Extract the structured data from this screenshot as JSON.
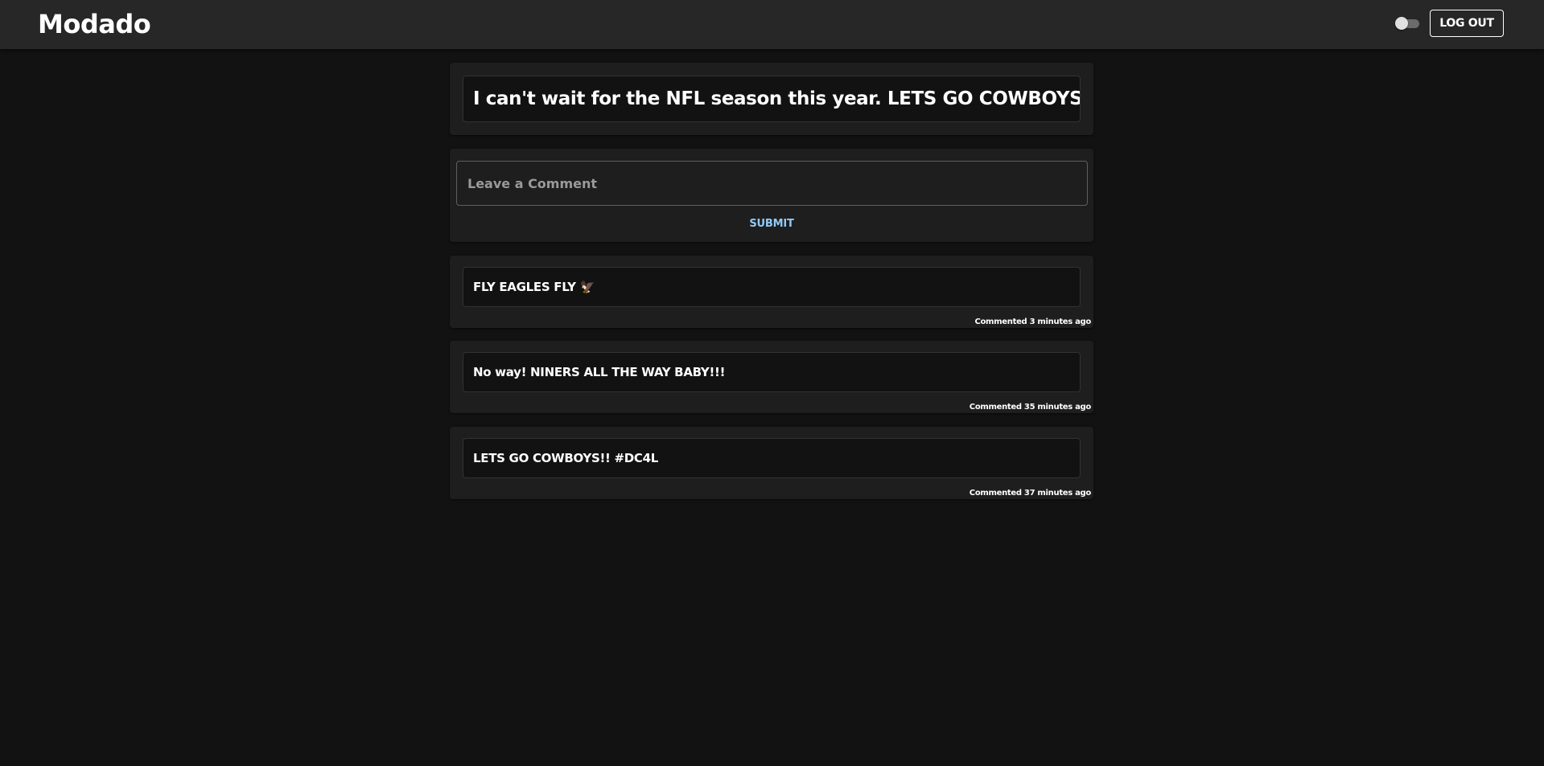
{
  "header": {
    "brand": "Modado",
    "logout_label": "LOG OUT"
  },
  "post": {
    "text": "I can't wait for the NFL season this year. LETS GO COWBOYS!!!"
  },
  "comment_form": {
    "placeholder": "Leave a Comment",
    "submit_label": "SUBMIT"
  },
  "comments": [
    {
      "text": "FLY EAGLES FLY 🦅",
      "time": "Commented 3 minutes ago"
    },
    {
      "text": "No way! NINERS ALL THE WAY BABY!!!",
      "time": "Commented 35 minutes ago"
    },
    {
      "text": "LETS GO COWBOYS!! #DC4L",
      "time": "Commented 37 minutes ago"
    }
  ],
  "theme": {
    "background": "#121212",
    "app_bar": "#272727",
    "card": "#1e1e1e",
    "accent": "#90caf9",
    "text": "#ffffff"
  },
  "icons": {
    "theme_toggle": "toggle-switch-icon"
  }
}
